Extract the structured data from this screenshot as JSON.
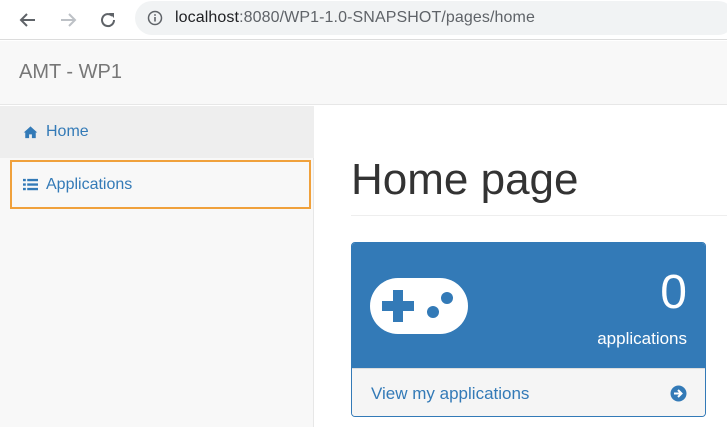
{
  "browser": {
    "url_host": "localhost",
    "url_rest": ":8080/WP1-1.0-SNAPSHOT/pages/home"
  },
  "navbar": {
    "brand": "AMT - WP1"
  },
  "sidebar": {
    "items": [
      {
        "label": "Home",
        "icon": "home-icon"
      },
      {
        "label": "Applications",
        "icon": "list-icon"
      }
    ]
  },
  "main": {
    "title": "Home page",
    "panel": {
      "count": "0",
      "count_label": "applications",
      "link_label": "View my applications",
      "icon": "gamepad-icon",
      "arrow_icon": "arrow-circle-right-icon"
    }
  },
  "colors": {
    "primary": "#337ab7",
    "focus_outline": "#f0a13c"
  }
}
